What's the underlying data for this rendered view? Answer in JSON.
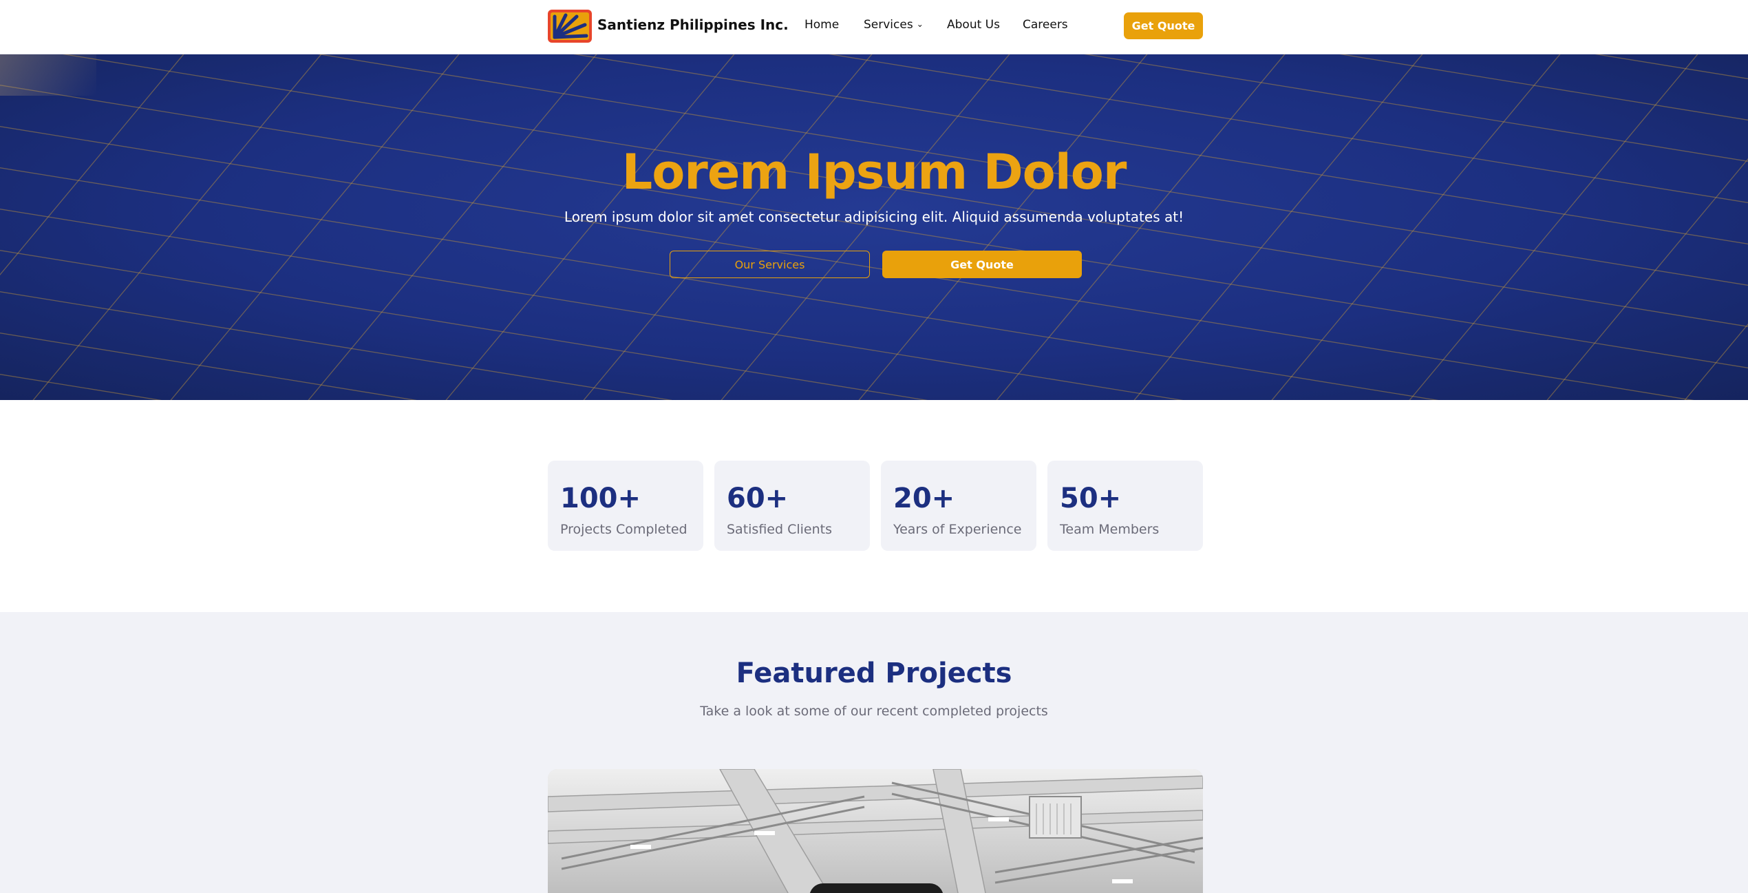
{
  "navbar": {
    "brand": "Santienz Philippines Inc.",
    "links": [
      {
        "label": "Home"
      },
      {
        "label": "Services",
        "has_dropdown": true
      },
      {
        "label": "About Us"
      },
      {
        "label": "Careers"
      }
    ],
    "cta_label": "Get Quote",
    "logo_icon": "sun-rays-logo-icon",
    "dropdown_icon": "chevron-down-icon"
  },
  "hero": {
    "title": "Lorem Ipsum Dolor",
    "subtitle": "Lorem ipsum dolor sit amet consectetur adipisicing elit. Aliquid assumenda voluptates at!",
    "primary_button": "Our Services",
    "secondary_button": "Get Quote"
  },
  "stats": [
    {
      "value": "100+",
      "label": "Projects Completed"
    },
    {
      "value": "60+",
      "label": "Satisfied Clients"
    },
    {
      "value": "20+",
      "label": "Years of Experience"
    },
    {
      "value": "50+",
      "label": "Team Members"
    }
  ],
  "featured": {
    "title": "Featured Projects",
    "subtitle": "Take a look at some of our recent completed projects"
  },
  "colors": {
    "brand_blue": "#1c2f80",
    "accent_orange": "#e9a10b",
    "logo_red": "#e8452a",
    "section_bg": "#f1f2f7"
  }
}
